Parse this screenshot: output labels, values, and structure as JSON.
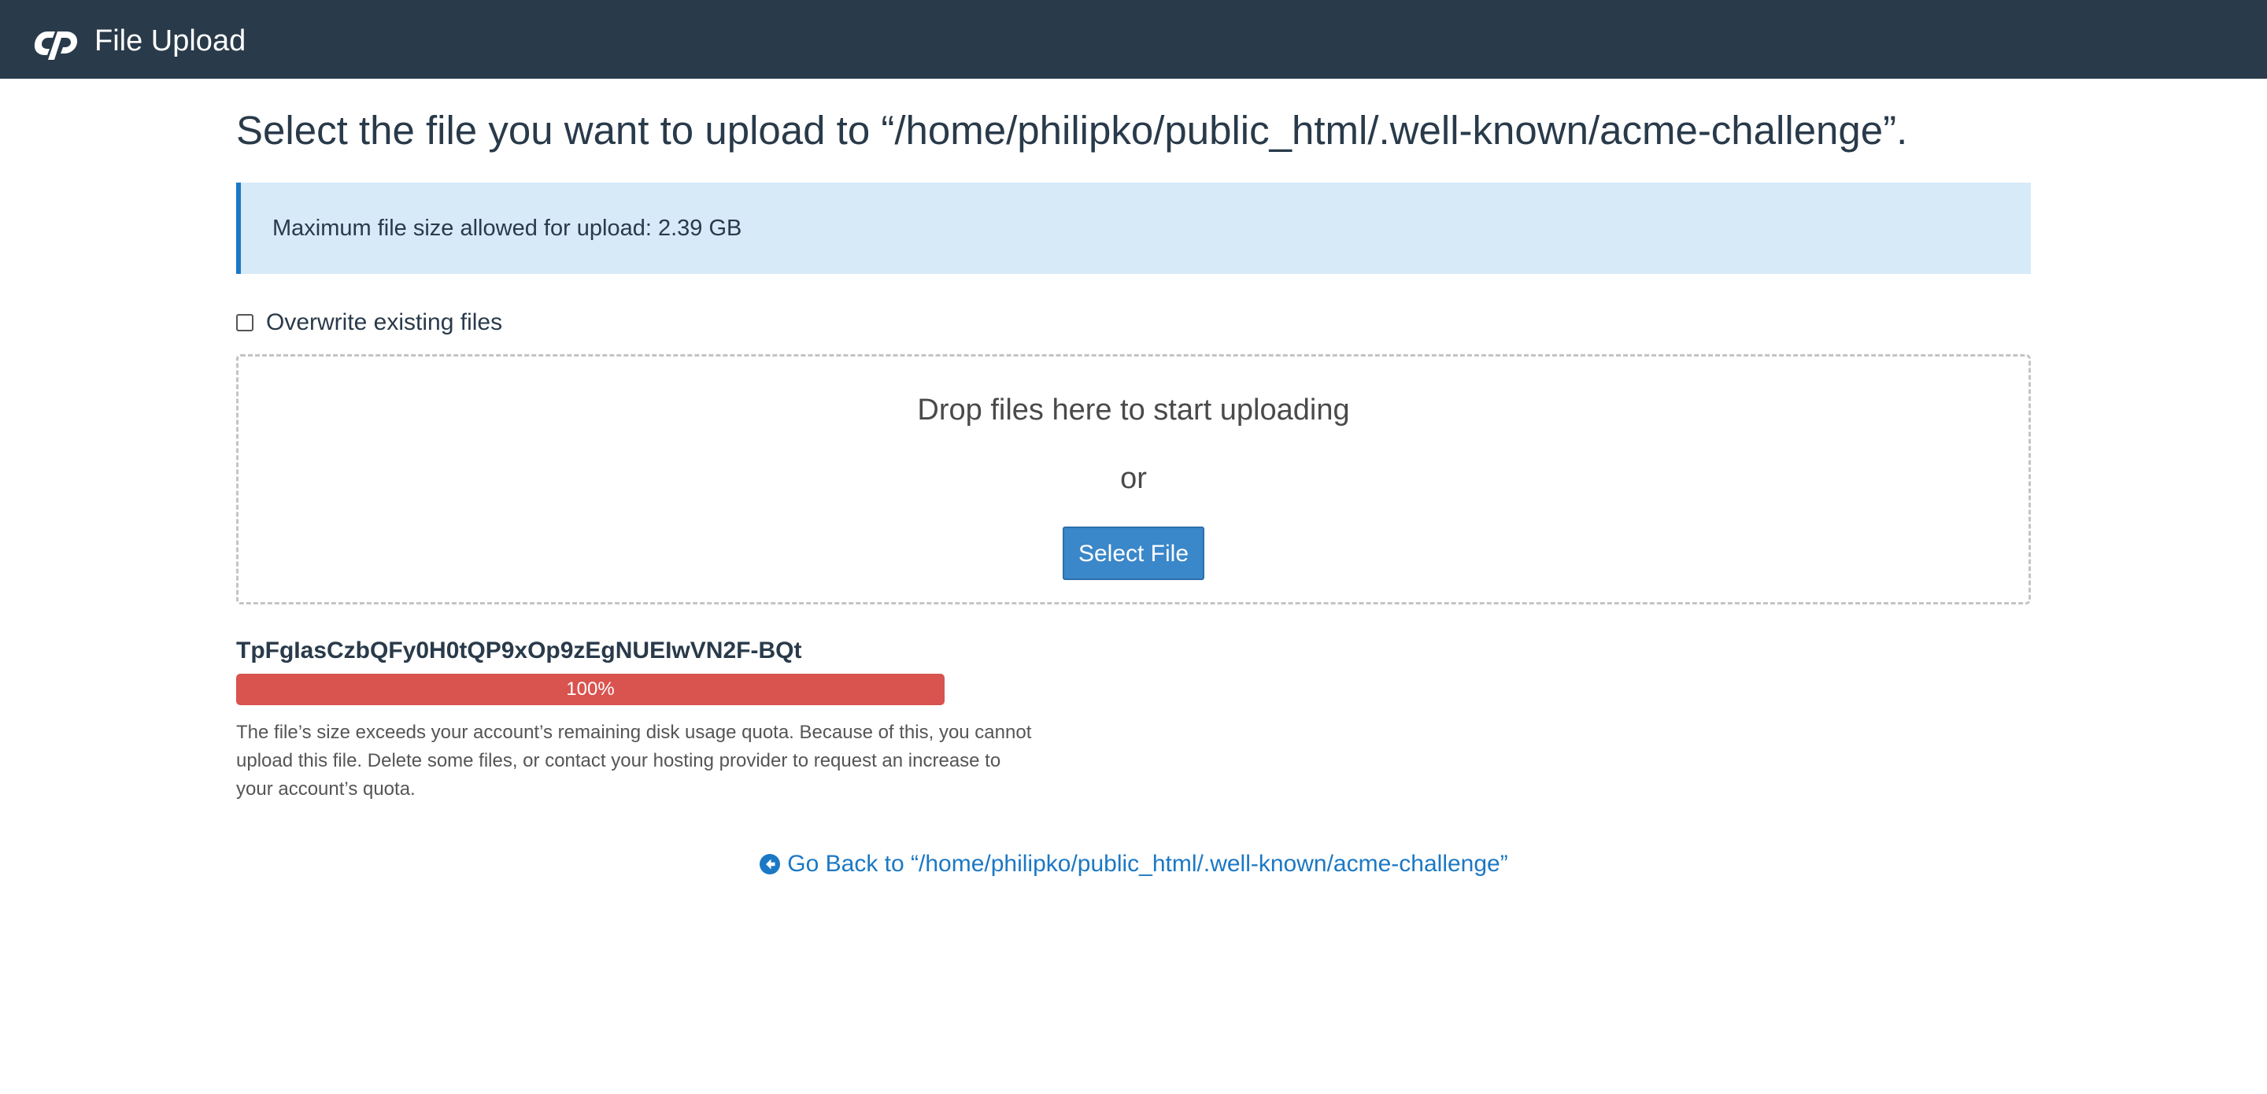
{
  "app": {
    "title": "File Upload",
    "logo_icon": "cpanel-logo-icon"
  },
  "page": {
    "heading": "Select the file you want to upload to “/home/philipko/public_html/.well-known/acme-challenge”."
  },
  "info": {
    "text": "Maximum file size allowed for upload: 2.39 GB"
  },
  "options": {
    "overwrite_label": "Overwrite existing files",
    "overwrite_checked": false
  },
  "dropzone": {
    "drop_text": "Drop files here to start uploading",
    "or_text": "or",
    "select_button_label": "Select File"
  },
  "upload": {
    "file_name": "TpFgIasCzbQFy0H0tQP9xOp9zEgNUEIwVN2F-BQt",
    "progress_percent": 100,
    "progress_label": "100%",
    "status_color": "#d9534f",
    "error_message": "The file’s size exceeds your account’s remaining disk usage quota. Because of this, you cannot upload this file. Delete some files, or contact your hosting provider to request an increase to your account’s quota."
  },
  "footer": {
    "back_link_text": "Go Back to “/home/philipko/public_html/.well-known/acme-challenge”",
    "back_icon": "arrow-circle-left-icon"
  },
  "colors": {
    "header_bg": "#293a4a",
    "accent": "#1b78c4",
    "info_bg": "#d7eaf8",
    "button_bg": "#3a87c9",
    "error": "#d9534f"
  }
}
